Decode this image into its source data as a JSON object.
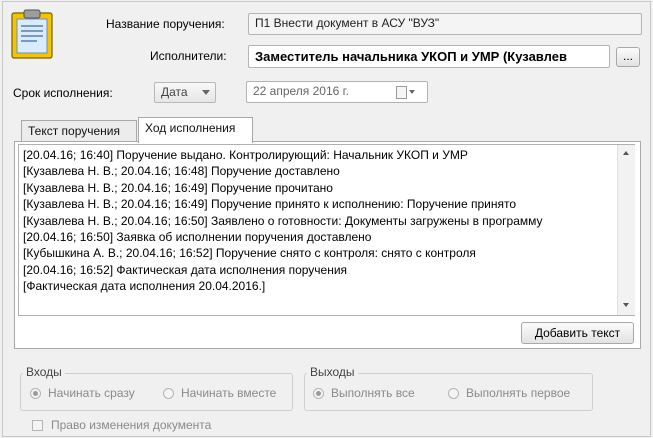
{
  "header": {
    "title_label": "Название поручения:",
    "title_value": "П1 Внести документ в АСУ \"ВУЗ\"",
    "executors_label": "Исполнители:",
    "executors_value": "Заместитель начальника УКОП и УМР (Кузавлев",
    "executors_button": "...",
    "deadline_label": "Срок исполнения:",
    "deadline_type": "Дата",
    "deadline_date": "22  апреля  2016 г."
  },
  "tabs": [
    {
      "label": "Текст поручения",
      "active": false
    },
    {
      "label": "Ход исполнения",
      "active": true
    }
  ],
  "log": {
    "lines": [
      "[20.04.16; 16:40] Поручение выдано. Контролирующий: Начальник УКОП и УМР",
      "[Кузавлева Н. В.; 20.04.16; 16:48] Поручение доставлено",
      "[Кузавлева Н. В.; 20.04.16; 16:49] Поручение прочитано",
      "[Кузавлева Н. В.; 20.04.16; 16:49] Поручение принято к исполнению: Поручение принято",
      "[Кузавлева Н. В.; 20.04.16; 16:50] Заявлено о готовности: Документы загружены в программу",
      "[20.04.16; 16:50] Заявка об исполнении поручения доставлено",
      "[Кубышкина А. В.; 20.04.16; 16:52] Поручение снято с контроля: снято с контроля",
      "[20.04.16; 16:52] Фактическая дата исполнения поручения",
      "[Фактическая дата исполнения 20.04.2016.]"
    ],
    "add_button": "Добавить текст"
  },
  "inputs_group": {
    "title": "Входы",
    "options": [
      {
        "label": "Начинать сразу",
        "selected": true
      },
      {
        "label": "Начинать вместе",
        "selected": false
      }
    ]
  },
  "outputs_group": {
    "title": "Выходы",
    "options": [
      {
        "label": "Выполнять все",
        "selected": true
      },
      {
        "label": "Выполнять первое",
        "selected": false
      }
    ]
  },
  "footer": {
    "edit_rights_label": "Право изменения документа"
  },
  "icons": {
    "task": "clipboard-icon"
  },
  "colors": {
    "clipboard": "#f5c400",
    "paper": "#d9ecff"
  }
}
